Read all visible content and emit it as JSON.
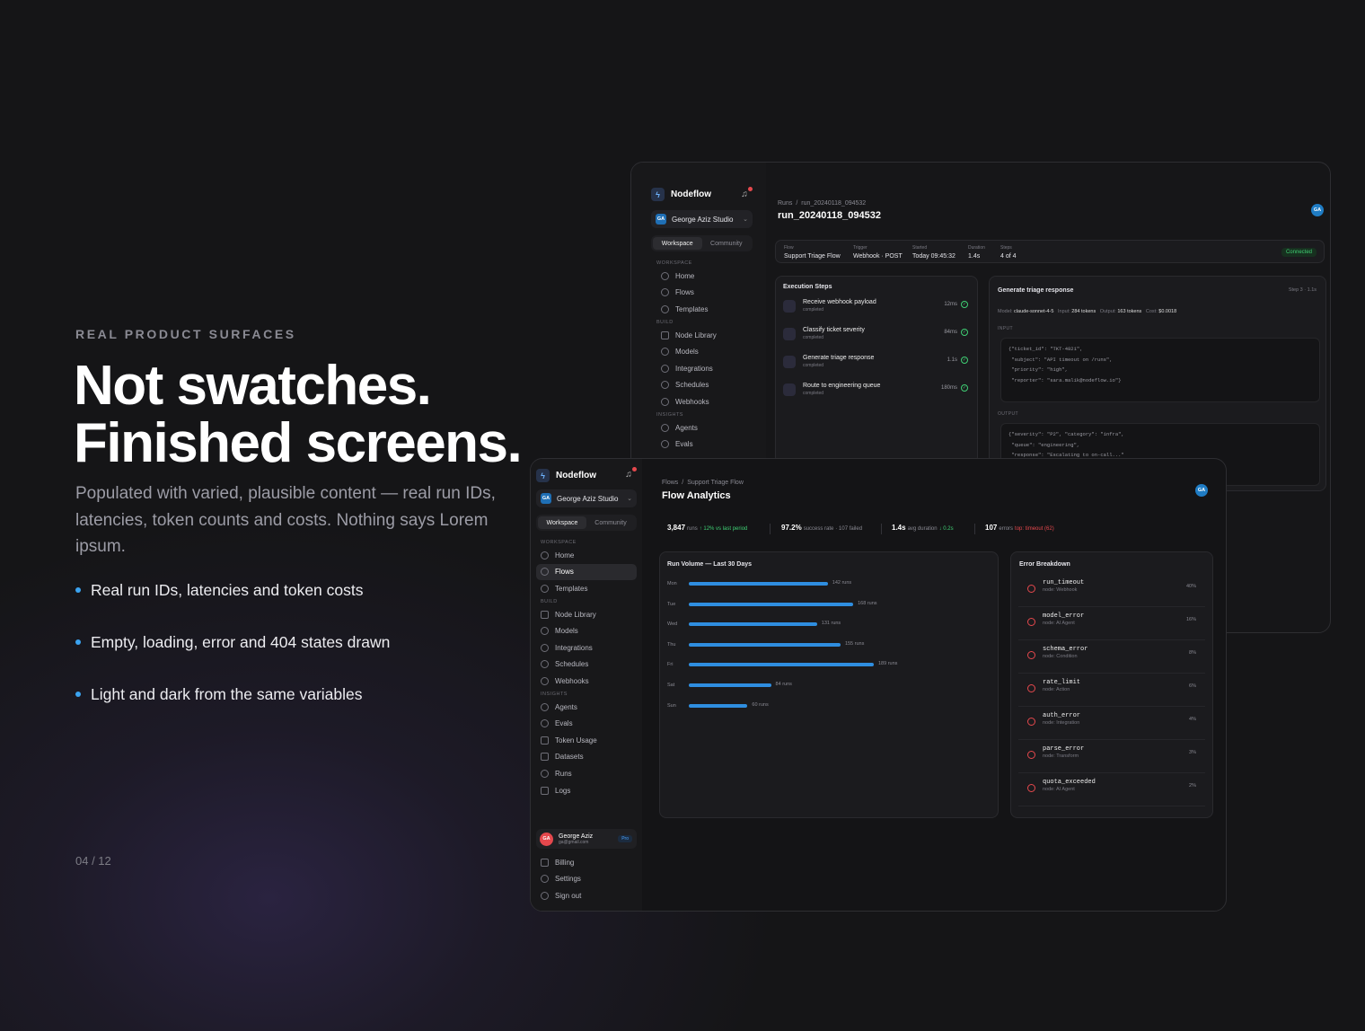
{
  "hero": {
    "eyebrow": "REAL PRODUCT SURFACES",
    "headline_line1": "Not swatches.",
    "headline_line2": "Finished screens.",
    "subcopy": "Populated with varied, plausible content — real run IDs, latencies, token counts and costs. Nothing says Lorem ipsum.",
    "bullets": [
      "Real run IDs, latencies and token costs",
      "Empty, loading, error and 404 states drawn",
      "Light and dark from the same variables"
    ],
    "pager": "04 / 12",
    "accent": "#3ba3f0"
  },
  "run_window": {
    "brand": "Nodeflow",
    "studio": "George Aziz Studio",
    "studio_initials": "GA",
    "tabs": [
      "Workspace",
      "Community"
    ],
    "sections": {
      "workspace": "WORKSPACE",
      "build": "BUILD",
      "insights": "INSIGHTS"
    },
    "nav": [
      "Home",
      "Flows",
      "Templates",
      "Node Library",
      "Models",
      "Integrations",
      "Schedules",
      "Webhooks",
      "Agents",
      "Evals"
    ],
    "breadcrumb": [
      "Runs",
      "run_20240118_094532"
    ],
    "title": "run_20240118_094532",
    "avatar": "GA",
    "meta": [
      {
        "label": "Flow",
        "value": "Support Triage Flow"
      },
      {
        "label": "Trigger",
        "value": "Webhook · POST"
      },
      {
        "label": "Started",
        "value": "Today 09:45:32"
      },
      {
        "label": "Duration",
        "value": "1.4s"
      },
      {
        "label": "Steps",
        "value": "4 of 4"
      }
    ],
    "status": "Connected",
    "steps_title": "Execution Steps",
    "steps": [
      {
        "name": "Receive webhook payload",
        "status": "completed",
        "duration": "12ms"
      },
      {
        "name": "Classify ticket severity",
        "status": "completed",
        "duration": "84ms"
      },
      {
        "name": "Generate triage response",
        "status": "completed",
        "duration": "1.1s"
      },
      {
        "name": "Route to engineering queue",
        "status": "completed",
        "duration": "180ms"
      }
    ],
    "detail": {
      "title": "Generate triage response",
      "step": "Step 3 · 1.1s",
      "model_label": "Model:",
      "model": "claude-sonnet-4-5",
      "input_label": "Input:",
      "input_tokens": "284 tokens",
      "output_label": "Output:",
      "output_tokens": "163 tokens",
      "cost_label": "Cost:",
      "cost": "$0.0018",
      "input_section": "INPUT",
      "input_json": "{\"ticket_id\": \"TKT-4821\",\n \"subject\": \"API timeout on /runs\",\n \"priority\": \"high\",\n \"reporter\": \"sara.malik@nodeflow.io\"}",
      "output_section": "OUTPUT",
      "output_json": "{\"severity\": \"P2\", \"category\": \"infra\",\n \"queue\": \"engineering\",\n \"response\": \"Escalating to on-call...\""
    }
  },
  "analytics_window": {
    "brand": "Nodeflow",
    "studio": "George Aziz Studio",
    "studio_initials": "GA",
    "tabs": [
      "Workspace",
      "Community"
    ],
    "sections": {
      "workspace": "WORKSPACE",
      "build": "BUILD",
      "insights": "INSIGHTS"
    },
    "nav": [
      "Home",
      "Flows",
      "Templates",
      "Node Library",
      "Models",
      "Integrations",
      "Schedules",
      "Webhooks",
      "Agents",
      "Evals",
      "Token Usage",
      "Datasets",
      "Runs",
      "Logs"
    ],
    "active_nav": "Flows",
    "breadcrumb": [
      "Flows",
      "Support Triage Flow"
    ],
    "title": "Flow Analytics",
    "avatar": "GA",
    "stats": [
      {
        "value": "3,847",
        "unit": "runs",
        "note": "↑ 12% vs last period",
        "tone": "good"
      },
      {
        "value": "97.2%",
        "unit": "success rate",
        "note": "· 107 failed",
        "tone": "muted"
      },
      {
        "value": "1.4s",
        "unit": "avg duration",
        "note": "↓ 0.2s",
        "tone": "good"
      },
      {
        "value": "107",
        "unit": "errors",
        "note": "top: timeout (62)",
        "tone": "bad"
      }
    ],
    "volume_title": "Run Volume — Last 30 Days",
    "error_title": "Error Breakdown",
    "errors": [
      {
        "name": "run_timeout",
        "node": "node: Webhook",
        "pct": "40%"
      },
      {
        "name": "model_error",
        "node": "node: AI Agent",
        "pct": "16%"
      },
      {
        "name": "schema_error",
        "node": "node: Condition",
        "pct": "8%"
      },
      {
        "name": "rate_limit",
        "node": "node: Action",
        "pct": "6%"
      },
      {
        "name": "auth_error",
        "node": "node: Integration",
        "pct": "4%"
      },
      {
        "name": "parse_error",
        "node": "node: Transform",
        "pct": "3%"
      },
      {
        "name": "quota_exceeded",
        "node": "node: AI Agent",
        "pct": "2%"
      }
    ],
    "user": {
      "name": "George Aziz",
      "email": "ga@gmail.com",
      "initials": "GA",
      "plan": "Pro"
    },
    "footer_nav": [
      "Billing",
      "Settings",
      "Sign out"
    ]
  },
  "chart_data": {
    "type": "bar",
    "orientation": "horizontal",
    "title": "Run Volume — Last 30 Days",
    "categories": [
      "Mon",
      "Tue",
      "Wed",
      "Thu",
      "Fri",
      "Sat",
      "Sun"
    ],
    "values": [
      142,
      168,
      131,
      155,
      189,
      84,
      60
    ],
    "value_labels": [
      "142 runs",
      "168 runs",
      "131 runs",
      "155 runs",
      "189 runs",
      "84 runs",
      "60 runs"
    ],
    "xlim": [
      0,
      189
    ],
    "color": "#2f8ee0",
    "grid": false
  }
}
